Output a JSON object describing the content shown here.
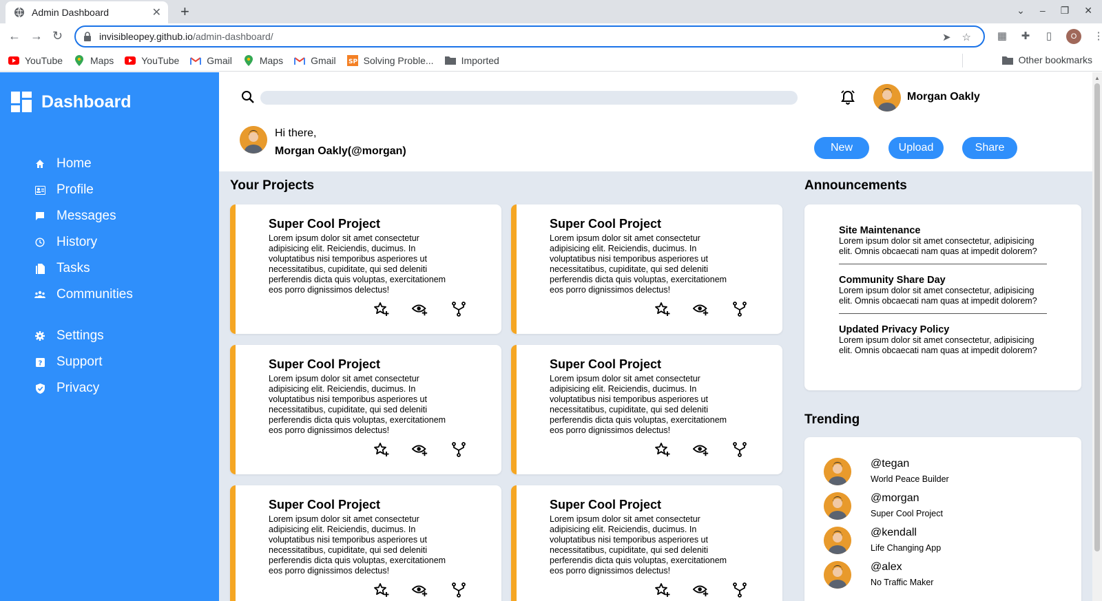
{
  "browser": {
    "tab_title": "Admin Dashboard",
    "url_domain": "invisibleopey.github.io",
    "url_path": "/admin-dashboard/",
    "profile_initial": "O",
    "bookmarks": [
      {
        "label": "YouTube",
        "icon": "youtube-icon"
      },
      {
        "label": "Maps",
        "icon": "maps-icon"
      },
      {
        "label": "YouTube",
        "icon": "youtube-icon"
      },
      {
        "label": "Gmail",
        "icon": "gmail-icon"
      },
      {
        "label": "Maps",
        "icon": "maps-icon"
      },
      {
        "label": "Gmail",
        "icon": "gmail-icon"
      },
      {
        "label": "Solving Proble...",
        "icon": "sp-icon"
      },
      {
        "label": "Imported",
        "icon": "folder-icon"
      }
    ],
    "other_bookmarks": "Other bookmarks"
  },
  "sidebar": {
    "title": "Dashboard",
    "items": [
      {
        "label": "Home",
        "icon": "home-icon"
      },
      {
        "label": "Profile",
        "icon": "profile-icon"
      },
      {
        "label": "Messages",
        "icon": "messages-icon"
      },
      {
        "label": "History",
        "icon": "history-icon"
      },
      {
        "label": "Tasks",
        "icon": "tasks-icon"
      },
      {
        "label": "Communities",
        "icon": "communities-icon"
      },
      {
        "label": "Settings",
        "icon": "settings-icon"
      },
      {
        "label": "Support",
        "icon": "support-icon"
      },
      {
        "label": "Privacy",
        "icon": "privacy-icon"
      }
    ]
  },
  "header": {
    "search_placeholder": "",
    "user_name": "Morgan Oakly",
    "greeting": "Hi there,",
    "greeting_name": "Morgan Oakly(@morgan)",
    "buttons": {
      "new": "New",
      "upload": "Upload",
      "share": "Share"
    }
  },
  "projects": {
    "title": "Your Projects",
    "items": [
      {
        "title": "Super Cool Project",
        "body": "Lorem ipsum dolor sit amet consectetur adipisicing elit. Reiciendis, ducimus. In voluptatibus nisi temporibus asperiores ut necessitatibus, cupiditate, qui sed deleniti perferendis dicta quis voluptas, exercitationem eos porro dignissimos delectus!"
      },
      {
        "title": "Super Cool Project",
        "body": "Lorem ipsum dolor sit amet consectetur adipisicing elit. Reiciendis, ducimus. In voluptatibus nisi temporibus asperiores ut necessitatibus, cupiditate, qui sed deleniti perferendis dicta quis voluptas, exercitationem eos porro dignissimos delectus!"
      },
      {
        "title": "Super Cool Project",
        "body": "Lorem ipsum dolor sit amet consectetur adipisicing elit. Reiciendis, ducimus. In voluptatibus nisi temporibus asperiores ut necessitatibus, cupiditate, qui sed deleniti perferendis dicta quis voluptas, exercitationem eos porro dignissimos delectus!"
      },
      {
        "title": "Super Cool Project",
        "body": "Lorem ipsum dolor sit amet consectetur adipisicing elit. Reiciendis, ducimus. In voluptatibus nisi temporibus asperiores ut necessitatibus, cupiditate, qui sed deleniti perferendis dicta quis voluptas, exercitationem eos porro dignissimos delectus!"
      },
      {
        "title": "Super Cool Project",
        "body": "Lorem ipsum dolor sit amet consectetur adipisicing elit. Reiciendis, ducimus. In voluptatibus nisi temporibus asperiores ut necessitatibus, cupiditate, qui sed deleniti perferendis dicta quis voluptas, exercitationem eos porro dignissimos delectus!"
      },
      {
        "title": "Super Cool Project",
        "body": "Lorem ipsum dolor sit amet consectetur adipisicing elit. Reiciendis, ducimus. In voluptatibus nisi temporibus asperiores ut necessitatibus, cupiditate, qui sed deleniti perferendis dicta quis voluptas, exercitationem eos porro dignissimos delectus!"
      }
    ]
  },
  "announcements": {
    "title": "Announcements",
    "items": [
      {
        "title": "Site Maintenance",
        "body": "Lorem ipsum dolor sit amet consectetur, adipisicing elit. Omnis obcaecati nam quas at impedit dolorem?"
      },
      {
        "title": "Community Share Day",
        "body": "Lorem ipsum dolor sit amet consectetur, adipisicing elit. Omnis obcaecati nam quas at impedit dolorem?"
      },
      {
        "title": "Updated Privacy Policy",
        "body": "Lorem ipsum dolor sit amet consectetur, adipisicing elit. Omnis obcaecati nam quas at impedit dolorem?"
      }
    ]
  },
  "trending": {
    "title": "Trending",
    "items": [
      {
        "handle": "@tegan",
        "project": "World Peace Builder"
      },
      {
        "handle": "@morgan",
        "project": "Super Cool Project"
      },
      {
        "handle": "@kendall",
        "project": "Life Changing App"
      },
      {
        "handle": "@alex",
        "project": "No Traffic Maker"
      }
    ]
  },
  "colors": {
    "sidebar": "#2f8ffb",
    "accent": "#f5a623",
    "background": "#e2e8f0"
  }
}
